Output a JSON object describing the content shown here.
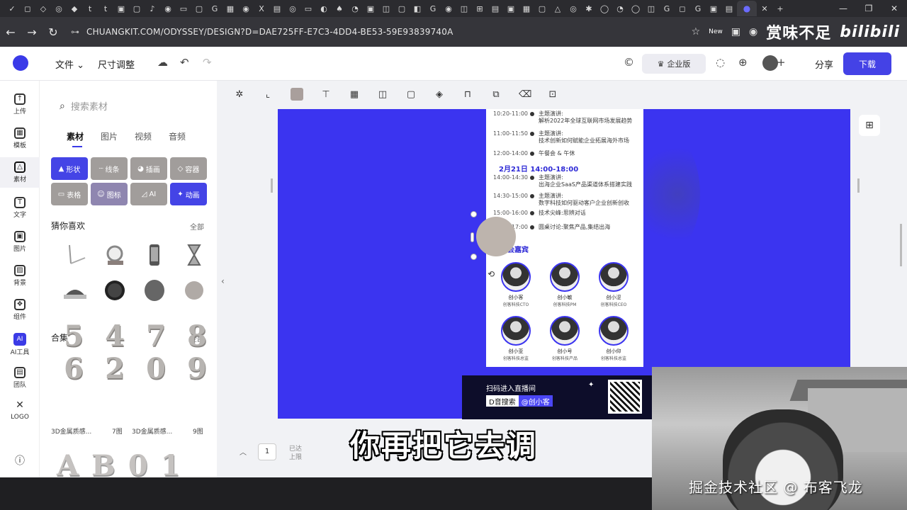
{
  "browser": {
    "url": "CHUANGKIT.COM/ODYSSEY/DESIGN?D=DAE725FF-E7C3-4DD4-BE53-59E93839740A",
    "brand_left": "赏味不足",
    "brand_right": "bilibili",
    "new_badge": "New"
  },
  "app_header": {
    "menu_file": "文件",
    "menu_resize": "尺寸调整",
    "upgrade_label": "企业版",
    "share_label": "分享",
    "download_label": "下载"
  },
  "rail": [
    {
      "label": "上传",
      "glyph": "↑"
    },
    {
      "label": "模板",
      "glyph": "▦"
    },
    {
      "label": "素材",
      "glyph": "△"
    },
    {
      "label": "文字",
      "glyph": "T"
    },
    {
      "label": "图片",
      "glyph": "▣"
    },
    {
      "label": "背景",
      "glyph": "▨"
    },
    {
      "label": "组件",
      "glyph": "❖"
    },
    {
      "label": "AI工具",
      "glyph": "AI"
    },
    {
      "label": "团队",
      "glyph": "▤"
    },
    {
      "label": "LOGO",
      "glyph": "✕"
    }
  ],
  "panel": {
    "search_placeholder": "搜索素材",
    "tabs": [
      "素材",
      "图片",
      "视频",
      "音频"
    ],
    "categories": [
      {
        "label": "形状",
        "style": "blue"
      },
      {
        "label": "线条",
        "style": "grey"
      },
      {
        "label": "插画",
        "style": "grey"
      },
      {
        "label": "容器",
        "style": "grey"
      },
      {
        "label": "表格",
        "style": "grey"
      },
      {
        "label": "图标",
        "style": "purple"
      },
      {
        "label": "AI",
        "style": "grey"
      },
      {
        "label": "动画",
        "style": "blue"
      }
    ],
    "guess_title": "猜你喜欢",
    "guess_more": "全部",
    "collection_title": "合集",
    "collection_more": "全部",
    "digits": [
      "5",
      "4",
      "7",
      "8",
      "6",
      "2",
      "0",
      "9"
    ],
    "collection_items": [
      {
        "name": "3D金属质感...",
        "count": "7图"
      },
      {
        "name": "3D金属质感...",
        "count": "9图"
      }
    ],
    "letters": [
      "A",
      "B",
      "0",
      "1"
    ]
  },
  "poster": {
    "schedule": [
      {
        "time": "10:20-11:00",
        "line1": "主题演讲:",
        "line2": "解析2022年全球互联网市场发展趋势"
      },
      {
        "time": "11:00-11:50",
        "line1": "主题演讲:",
        "line2": "技术创新如何赋能企业拓展海外市场"
      },
      {
        "time": "12:00-14:00",
        "line1": "午餐会 & 午休",
        "line2": ""
      },
      {
        "time": "14:00-14:30",
        "line1": "主题演讲:",
        "line2": "出海企业SaaS产品渠道体系搭建实践"
      },
      {
        "time": "14:30-15:00",
        "line1": "主题演讲:",
        "line2": "数字科技如何驱动客户企业创新创收"
      },
      {
        "time": "15:00-16:00",
        "line1": "技术尖峰:思辨对话",
        "line2": ""
      },
      {
        "time": "16:00-17:00",
        "line1": "圆桌讨论:聚焦产品,集结出海",
        "line2": ""
      }
    ],
    "day_heading": "2月21日 14:00-18:00",
    "guest_heading": "参会嘉宾",
    "guests": [
      {
        "name": "创小客",
        "role": "创客科技CTO"
      },
      {
        "name": "创小敏",
        "role": "创客科技PM"
      },
      {
        "name": "创小涩",
        "role": "创客科技CEO"
      },
      {
        "name": "创小亚",
        "role": "创客科技总监"
      },
      {
        "name": "创小号",
        "role": "创客科技产品"
      },
      {
        "name": "创小仰",
        "role": "创客科技总监"
      }
    ],
    "promo_text": "扫码进入直播间",
    "promo_search": "D音搜索",
    "promo_account": "@创小客"
  },
  "bottom": {
    "page_number": "1",
    "page_hint": "已达上限"
  },
  "subtitle": "你再把它去调",
  "webcam_caption": "掘金技术社区 @ 布客飞龙"
}
